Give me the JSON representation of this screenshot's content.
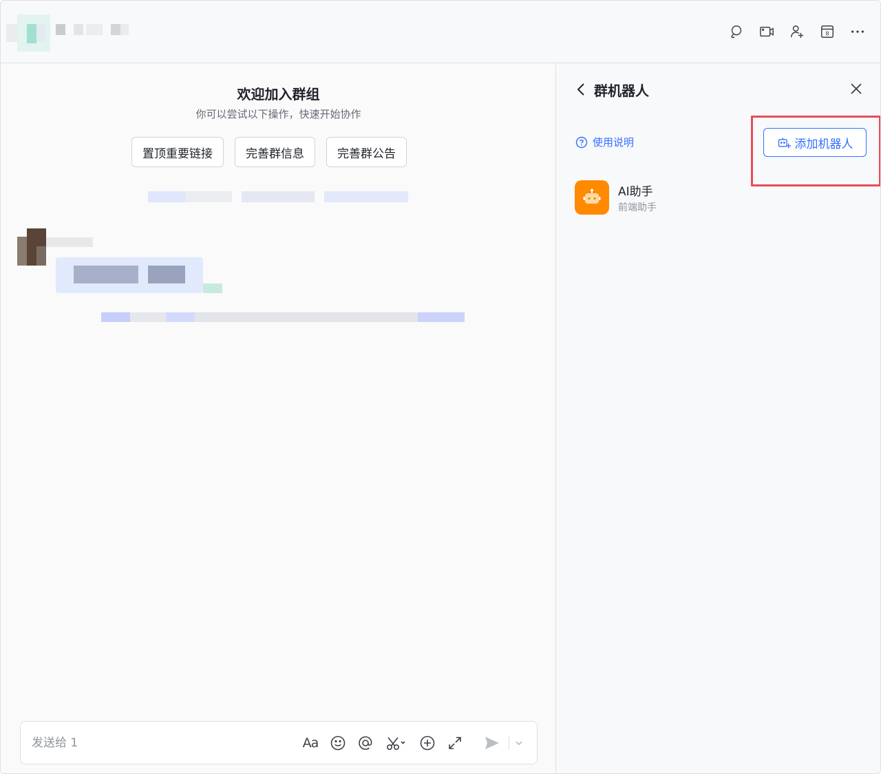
{
  "chat": {
    "welcome_title": "欢迎加入群组",
    "welcome_subtitle": "你可以尝试以下操作，快速开始协作",
    "quick_actions": [
      {
        "label": "置顶重要链接"
      },
      {
        "label": "完善群信息"
      },
      {
        "label": "完善群公告"
      }
    ]
  },
  "header": {
    "icons": [
      "search-icon",
      "video-call-icon",
      "add-member-icon",
      "calendar-icon",
      "more-icon"
    ],
    "calendar_day": "8"
  },
  "composer": {
    "placeholder": "发送给 1",
    "tools": [
      "text-format-icon",
      "emoji-icon",
      "mention-icon",
      "screenshot-icon",
      "add-icon",
      "expand-icon"
    ],
    "format_glyph": "Aa"
  },
  "panel": {
    "title": "群机器人",
    "help_label": "使用说明",
    "add_bot_label": "添加机器人",
    "bots": [
      {
        "name": "AI助手",
        "description": "前端助手"
      }
    ]
  },
  "colors": {
    "accent": "#3370ff",
    "highlight": "#e94b56",
    "bot_avatar": "#ff8a00"
  }
}
